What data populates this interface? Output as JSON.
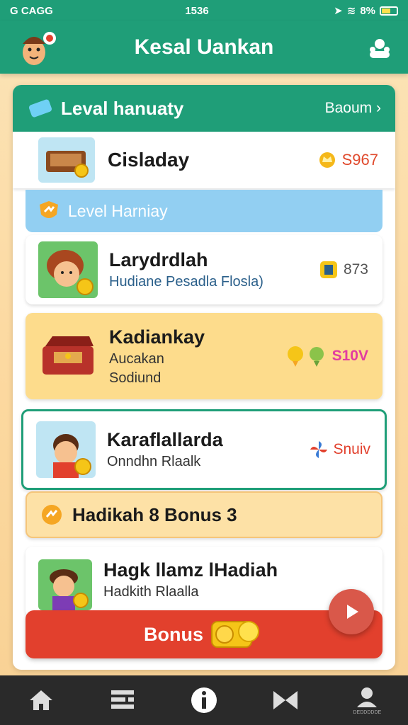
{
  "status": {
    "carrier": "G CAGG",
    "time": "1536",
    "battery": "8%"
  },
  "app": {
    "title": "Kesal Uankan"
  },
  "panel": {
    "title": "Leval hanuaty",
    "link": "Baoum",
    "top_item": {
      "name": "Cisladay",
      "value": "S967"
    },
    "subheader": "Level Harniay"
  },
  "items": [
    {
      "name": "Larydrdlah",
      "sub": "Hudiane Pesadla Flosla)",
      "value": "873"
    },
    {
      "name": "Kadiankay",
      "sub": "Aucakan",
      "sub2": "Sodiund",
      "value": "S10V"
    },
    {
      "name": "Karaflallarda",
      "sub": "Onndhn Rlaalk",
      "value": "Snuiv"
    }
  ],
  "bonus_banner": {
    "title": "Hadikah 8 Bonus 3"
  },
  "last_item": {
    "name": "Hagk llamz lHadiah",
    "sub": "Hadkith Rlaalla"
  },
  "bonus_button": {
    "label": "Bonus"
  },
  "nav": [
    {
      "icon": "home-icon"
    },
    {
      "icon": "list-icon"
    },
    {
      "icon": "info-icon"
    },
    {
      "icon": "bowtie-icon"
    },
    {
      "icon": "profile-icon",
      "caption": "DEDDDDDE"
    }
  ],
  "colors": {
    "primary": "#1f9e78",
    "accent": "#e2402d",
    "sky": "#92cff2",
    "gold": "#fddc8c"
  }
}
